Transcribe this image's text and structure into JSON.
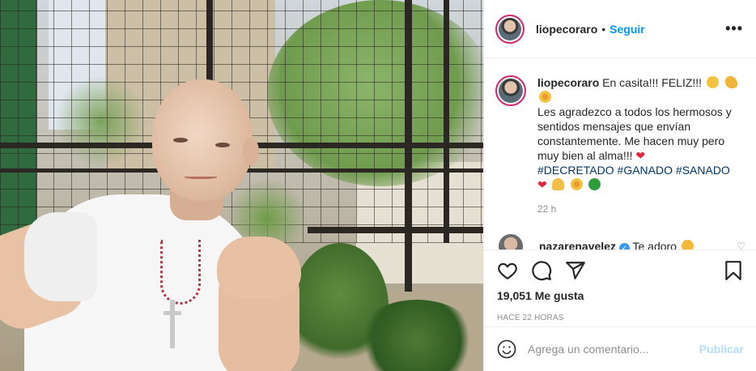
{
  "post": {
    "username": "liopecoraro",
    "dot": "•",
    "follow_label": "Seguir",
    "more_label": "•••"
  },
  "caption": {
    "username": "liopecoraro",
    "line1": "En casita!!! FELIZ!!!",
    "line2": "Les agradezco a todos los hermosos y sentidos mensajes que envían constantemente. Me hacen muy pero muy bien al alma!!!",
    "hashtags": [
      "#DECRETADO",
      "#GANADO",
      "#SANADO"
    ],
    "time": "22 h"
  },
  "reply": {
    "username": "nazarenavelez",
    "text": "Te adoro"
  },
  "actions": {
    "like_icon": "heart-icon",
    "comment_icon": "comment-icon",
    "share_icon": "paper-plane-icon",
    "save_icon": "bookmark-icon"
  },
  "likes": "19,051 Me gusta",
  "posted_ago": "HACE 22 HORAS",
  "comment_input": {
    "placeholder": "Agrega un comentario...",
    "value": ""
  },
  "publish_label": "Publicar",
  "colors": {
    "accent": "#0095f6",
    "publish_disabled": "#b2dffc",
    "hashtag": "#00376b",
    "muted": "#8e8e8e"
  }
}
